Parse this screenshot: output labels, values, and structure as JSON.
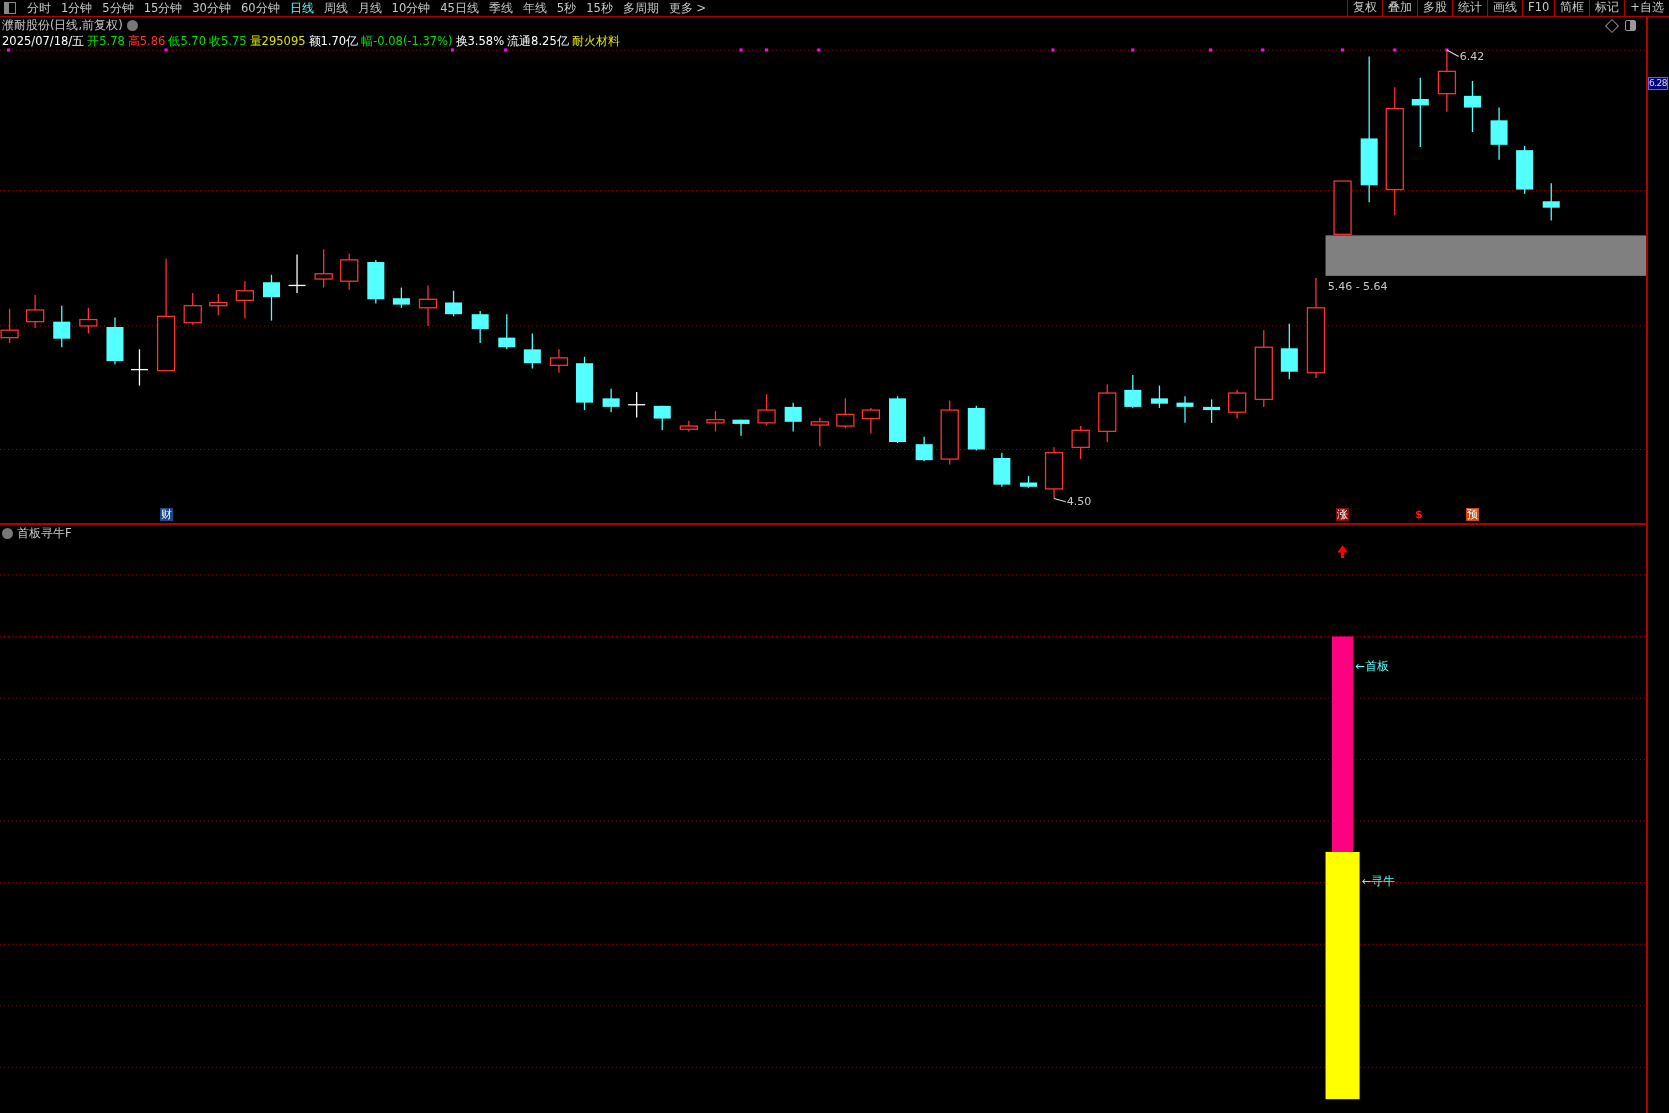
{
  "toolbar": {
    "periods": [
      {
        "label": "分时",
        "selected": false
      },
      {
        "label": "1分钟",
        "selected": false
      },
      {
        "label": "5分钟",
        "selected": false
      },
      {
        "label": "15分钟",
        "selected": false
      },
      {
        "label": "30分钟",
        "selected": false
      },
      {
        "label": "60分钟",
        "selected": false
      },
      {
        "label": "日线",
        "selected": true
      },
      {
        "label": "周线",
        "selected": false
      },
      {
        "label": "月线",
        "selected": false
      },
      {
        "label": "10分钟",
        "selected": false
      },
      {
        "label": "45日线",
        "selected": false
      },
      {
        "label": "季线",
        "selected": false
      },
      {
        "label": "年线",
        "selected": false
      },
      {
        "label": "5秒",
        "selected": false
      },
      {
        "label": "15秒",
        "selected": false
      },
      {
        "label": "多周期",
        "selected": false
      },
      {
        "label": "更多 >",
        "selected": false
      }
    ],
    "tools": [
      "复权",
      "叠加",
      "多股",
      "统计",
      "画线",
      "F10",
      "简框",
      "标记",
      "+自选"
    ]
  },
  "main_chart": {
    "title": "濮耐股份(日线,前复权)",
    "quote": [
      {
        "text": "2025/07/18/五",
        "color": "#ffffff"
      },
      {
        "text": "开5.78",
        "color": "#00e000"
      },
      {
        "text": "高5.86",
        "color": "#ff3030"
      },
      {
        "text": "低5.70",
        "color": "#00e000"
      },
      {
        "text": "收5.75",
        "color": "#00e000"
      },
      {
        "text": "量295095",
        "color": "#e0e000"
      },
      {
        "text": "额1.70亿",
        "color": "#ffffff"
      },
      {
        "text": "幅-0.08(-1.37%)",
        "color": "#00e000"
      },
      {
        "text": "换3.58%",
        "color": "#ffffff"
      },
      {
        "text": "流通8.25亿",
        "color": "#ffffff"
      },
      {
        "text": "耐火材料",
        "color": "#e0e000"
      }
    ],
    "price_labels": [
      "6.42",
      "4.50"
    ],
    "zone_label": "5.46 - 5.64",
    "badges": [
      {
        "text": "财",
        "kind": "boxed",
        "color": "#1a4a8a"
      },
      {
        "text": "涨",
        "kind": "boxed",
        "color": "#8a0a0a"
      },
      {
        "text": "$",
        "kind": "plain",
        "color": "#ff1010"
      },
      {
        "text": "预",
        "kind": "boxed",
        "color": "#c84a10"
      }
    ]
  },
  "price_axis": {
    "current": "6.28"
  },
  "indicator": {
    "title": "首板寻牛F",
    "labels": [
      "←首板",
      "←寻牛"
    ]
  }
}
